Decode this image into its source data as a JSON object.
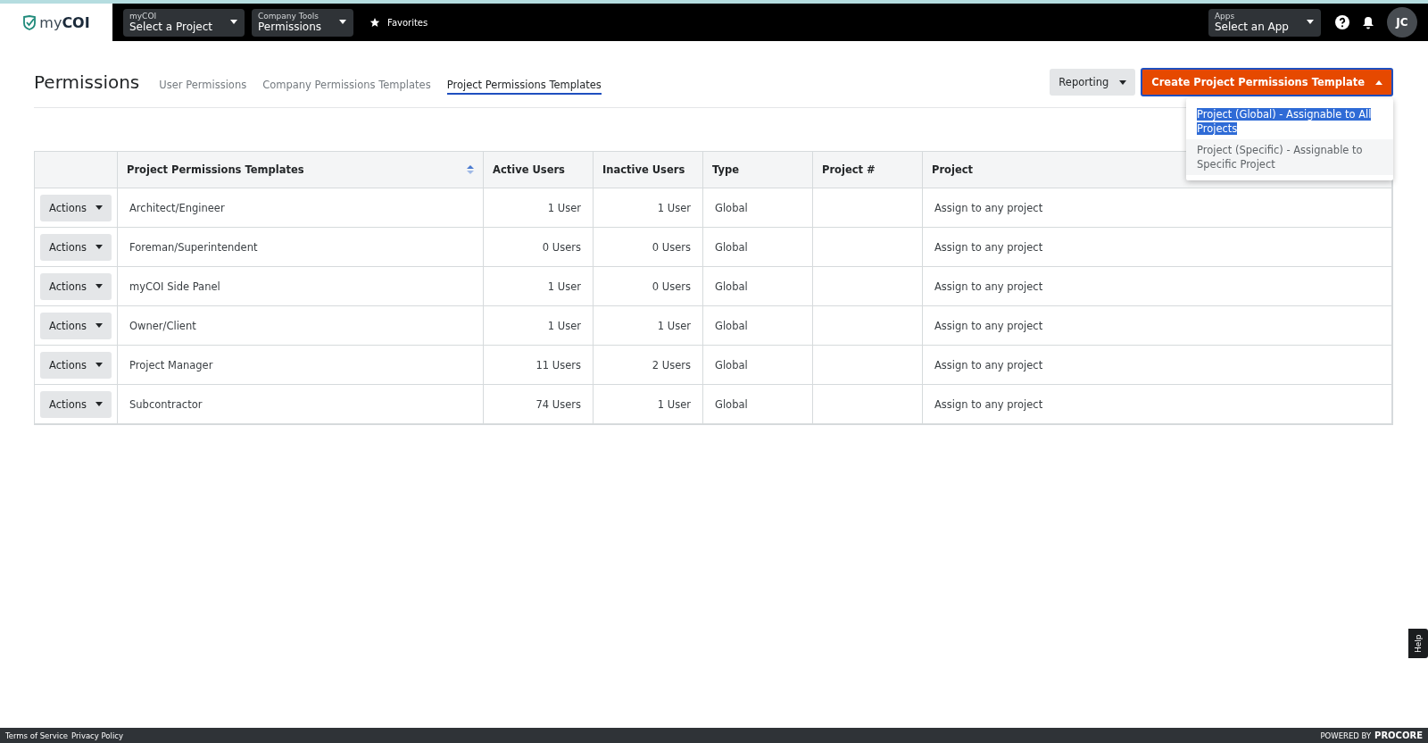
{
  "topbar": {
    "logo": {
      "light": "my",
      "bold": "COI"
    },
    "selectors": [
      {
        "caption": "myCOI",
        "value": "Select a Project"
      },
      {
        "caption": "Company Tools",
        "value": "Permissions"
      }
    ],
    "favorites": "Favorites",
    "apps": {
      "caption": "Apps",
      "value": "Select an App"
    },
    "avatar": "JC"
  },
  "page": {
    "title": "Permissions",
    "tabs": [
      {
        "label": "User Permissions",
        "selected": false
      },
      {
        "label": "Company Permissions Templates",
        "selected": false
      },
      {
        "label": "Project Permissions Templates",
        "selected": true
      }
    ],
    "reporting_button": "Reporting",
    "create_button": {
      "label": "Create Project Permissions Template",
      "expanded": true
    },
    "create_menu": [
      {
        "label": "Project (Global) - Assignable to All Projects",
        "selected": true
      },
      {
        "label": "Project (Specific) - Assignable to Specific Project",
        "selected": false
      }
    ]
  },
  "table": {
    "columns": [
      "Project Permissions Templates",
      "Active Users",
      "Inactive Users",
      "Type",
      "Project #",
      "Project"
    ],
    "rows": [
      {
        "action": "Actions",
        "name": "Architect/Engineer",
        "active": "1 User",
        "inactive": "1 User",
        "type": "Global",
        "project": "Assign to any project"
      },
      {
        "action": "Actions",
        "name": "Foreman/Superintendent",
        "active": "0 Users",
        "inactive": "0 Users",
        "type": "Global",
        "project": "Assign to any project"
      },
      {
        "action": "Actions",
        "name": "myCOI Side Panel",
        "active": "1 User",
        "inactive": "0 Users",
        "type": "Global",
        "project": "Assign to any project"
      },
      {
        "action": "Actions",
        "name": "Owner/Client",
        "active": "1 User",
        "inactive": "1 User",
        "type": "Global",
        "project": "Assign to any project"
      },
      {
        "action": "Actions",
        "name": "Project Manager",
        "active": "11 Users",
        "inactive": "2 Users",
        "type": "Global",
        "project": "Assign to any project"
      },
      {
        "action": "Actions",
        "name": "Subcontractor",
        "active": "74 Users",
        "inactive": "1 User",
        "type": "Global",
        "project": "Assign to any project"
      }
    ]
  },
  "help_tab": "Help",
  "footer": {
    "links": [
      "Terms of Service",
      "Privacy Policy"
    ],
    "powered_by": "POWERED BY",
    "brand": "PROCORE"
  }
}
